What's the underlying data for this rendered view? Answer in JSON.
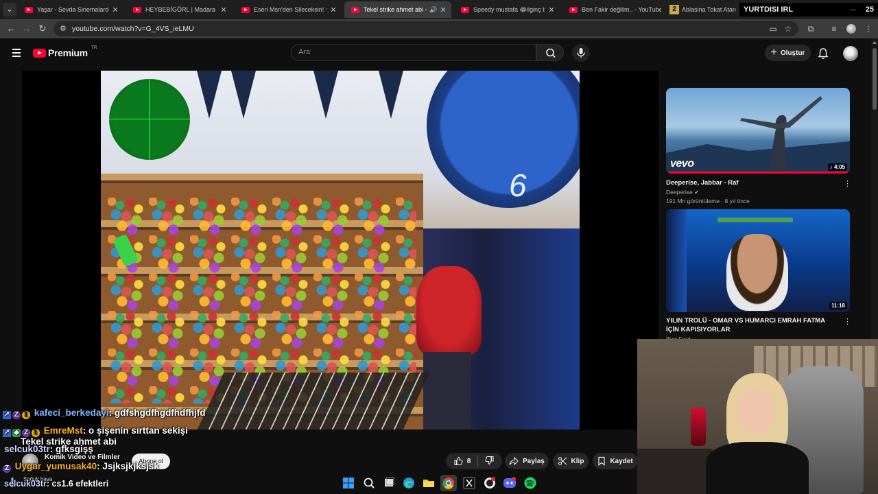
{
  "browser": {
    "tabs": [
      {
        "title": "Yaşar - Sevda Sinemalarda - Yo",
        "active": false
      },
      {
        "title": "HEYBEBİGÖRL | Madara Olduk",
        "active": false
      },
      {
        "title": "Eseri Msn'den Sileceksin! 😡 - ",
        "active": false
      },
      {
        "title": "Tekel strike ahmet abi - You",
        "active": true
      },
      {
        "title": "Speedy mustafa 😂ilginç bir h",
        "active": false
      },
      {
        "title": "Ben Fakir değilim.. - YouTube",
        "active": false
      },
      {
        "title": "Ablasina Tokat Atan Kız",
        "active": false,
        "badge": "2"
      }
    ],
    "url": "youtube.com/watch?v=G_4VS_ieLMU"
  },
  "stream_overlay": {
    "banner_text": "YURTDISI IRL",
    "banner_number": "25"
  },
  "youtube": {
    "logo_text": "Premium",
    "region": "TR",
    "search_placeholder": "Ara",
    "create_label": "Oluştur"
  },
  "video": {
    "title_overlay": "Tekel strike ahmet abi",
    "channel_name": "Komik Video ve Filmler",
    "subscribe_label": "Abone ol",
    "likes": "8",
    "share_label": "Paylaş",
    "clip_label": "Klip",
    "save_label": "Kaydet"
  },
  "chat": [
    {
      "user": "kafeci_berkedayi",
      "message": ": gdfshgdfhgdfhdfhjfd"
    },
    {
      "user": "EmreMst",
      "message": ": o şişenin sırttan sekişi"
    },
    {
      "user": "selcuk03tr",
      "message": ": gfksgişş"
    },
    {
      "user": "Uygar_yumusak40",
      "message": ": Jsjksjkjksjsk"
    },
    {
      "user": "selcuk03tr",
      "message": ": cs1.6 efektleri"
    }
  ],
  "sidebar": {
    "recommendations": [
      {
        "title": "Deeperise, Jabbar - Raf",
        "channel": "Deeperise",
        "meta": "191 Mn görüntüleme · 8 yıl önce",
        "duration": "4:05",
        "thumb_brand": "vevo"
      },
      {
        "title": "YILIN TROLÜ - OMAR VS HUMARCI EMRAH FATMA İÇİN KAPISIYORLAR",
        "channel": "İlker Fırat",
        "duration": "11:18"
      }
    ]
  },
  "taskbar": {
    "weather": "Soğuk hava"
  },
  "colors": {
    "yt_red": "#ff0033",
    "background": "#0f0f0f",
    "chip": "#272727"
  }
}
